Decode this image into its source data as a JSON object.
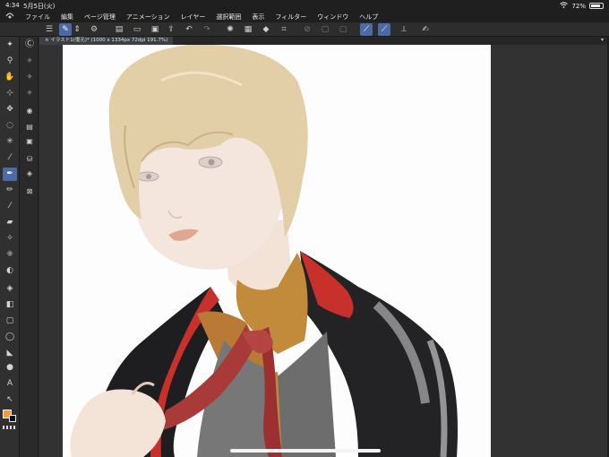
{
  "status": {
    "time": "4:34",
    "date": "5月5日(火)",
    "battery": "72%",
    "battery_level": 0.72
  },
  "menu": [
    "ファイル",
    "編集",
    "ページ管理",
    "アニメーション",
    "レイヤー",
    "選択範囲",
    "表示",
    "フィルター",
    "ウィンドウ",
    "ヘルプ"
  ],
  "document": {
    "tab_label": "イラスト1(復元)* (1000 x 1334px 72dpi 191.7%)"
  },
  "colors": {
    "main": "#f09a3a",
    "sub": "#111111",
    "accent": "#4a6ba3"
  }
}
